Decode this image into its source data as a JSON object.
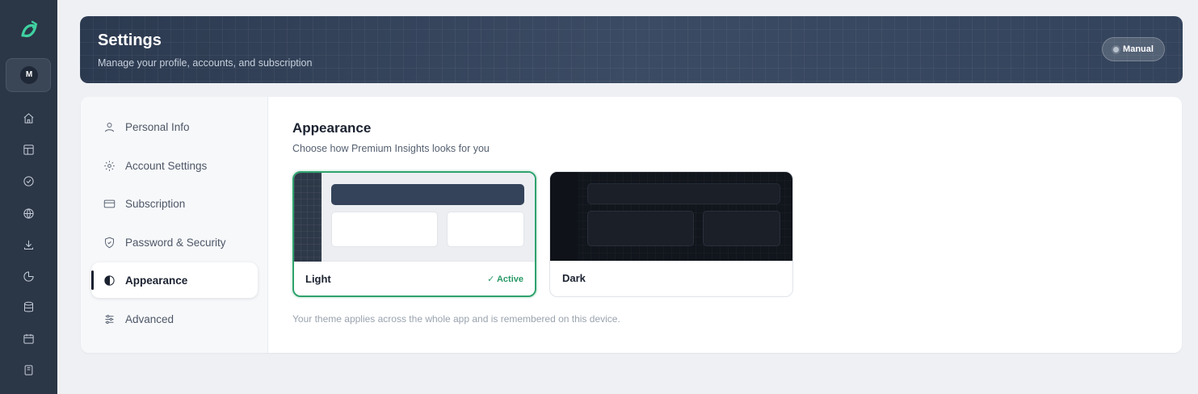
{
  "app": {
    "logo_name": "brand-logo",
    "avatar_initial": "M",
    "accent_color": "#2ea26d",
    "rail_color": "#2b3646"
  },
  "rail": {
    "icons": [
      "home-icon",
      "layout-icon",
      "check-circle-icon",
      "globe-icon",
      "download-icon",
      "pie-chart-icon",
      "database-icon",
      "calendar-icon",
      "book-icon"
    ]
  },
  "header": {
    "title": "Settings",
    "subtitle": "Manage your profile, accounts, and subscription",
    "mode_label": "Manual"
  },
  "sidebar": {
    "items": [
      {
        "label": "Personal Info",
        "icon": "user-icon",
        "active": false
      },
      {
        "label": "Account Settings",
        "icon": "gear-icon",
        "active": false
      },
      {
        "label": "Subscription",
        "icon": "credit-card-icon",
        "active": false
      },
      {
        "label": "Password & Security",
        "icon": "shield-icon",
        "active": false
      },
      {
        "label": "Appearance",
        "icon": "contrast-icon",
        "active": true
      },
      {
        "label": "Advanced",
        "icon": "sliders-icon",
        "active": false
      }
    ]
  },
  "appearance": {
    "heading": "Appearance",
    "description": "Choose how Premium Insights looks for you",
    "themes": [
      {
        "label": "Light",
        "selected": true,
        "badge": "✓ Active"
      },
      {
        "label": "Dark",
        "selected": false
      }
    ],
    "footnote": "Your theme applies across the whole app and is remembered on this device."
  }
}
